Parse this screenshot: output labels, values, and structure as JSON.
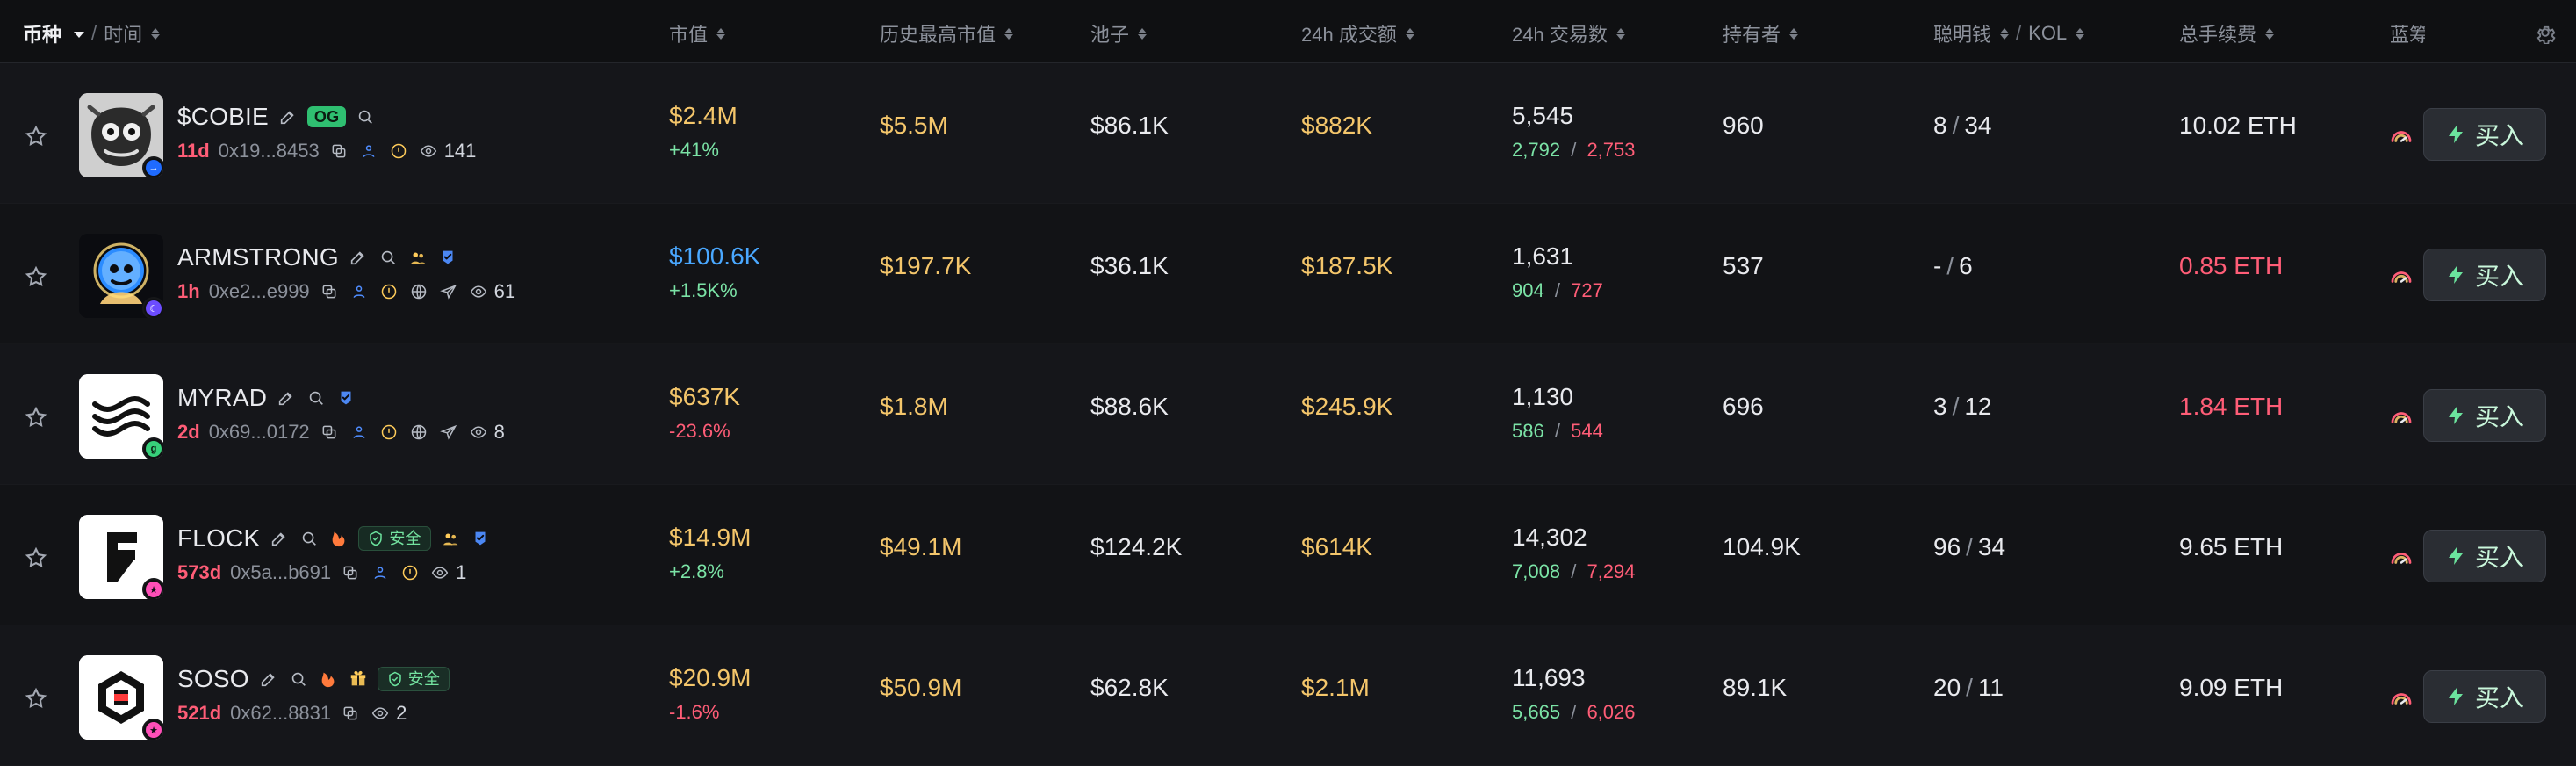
{
  "header": {
    "coin": "币种",
    "time": "时间",
    "slash": "/",
    "mcap": "市值",
    "ath_mcap": "历史最高市值",
    "pool": "池子",
    "vol24h": "24h 成交额",
    "tx24h": "24h 交易数",
    "holders": "持有者",
    "smart": "聪明钱",
    "kol": "KOL",
    "fees": "总手续费",
    "clipped": "蓝筹"
  },
  "colors": {
    "accent_green": "#7be3a6",
    "accent_red": "#ff5d77",
    "accent_gold": "#f4c66b",
    "accent_blue": "#4aa8ff"
  },
  "rows": [
    {
      "symbol": "$COBIE",
      "age": "11d",
      "address": "0x19...8453",
      "views": "141",
      "badges": {
        "og": "OG",
        "safe": ""
      },
      "mcap": "$2.4M",
      "mcap_change": "+41%",
      "mcap_change_dir": "up",
      "ath_mcap": "$5.5M",
      "pool": "$86.1K",
      "vol24h": "$882K",
      "tx24h": "5,545",
      "buys": "2,792",
      "sells": "2,753",
      "holders": "960",
      "smart": "8",
      "kol": "34",
      "fees": "10.02 ETH",
      "fees_color": "normal",
      "buy_label": "买入",
      "avatar_style": "cobie",
      "sticker_icon": "arrow-right-circle-icon",
      "sticker_color": "#1f6bff"
    },
    {
      "symbol": "ARMSTRONG",
      "age": "1h",
      "address": "0xe2...e999",
      "views": "61",
      "badges": {
        "og": "",
        "safe": ""
      },
      "mcap": "$100.6K",
      "mcap_change": "+1.5K%",
      "mcap_change_dir": "up",
      "ath_mcap": "$197.7K",
      "pool": "$36.1K",
      "vol24h": "$187.5K",
      "tx24h": "1,631",
      "buys": "904",
      "sells": "727",
      "holders": "537",
      "smart": "-",
      "kol": "6",
      "fees": "0.85 ETH",
      "fees_color": "red",
      "buy_label": "买入",
      "avatar_style": "armstrong",
      "sticker_icon": "moon-icon",
      "sticker_color": "#6c4cff"
    },
    {
      "symbol": "MYRAD",
      "age": "2d",
      "address": "0x69...0172",
      "views": "8",
      "badges": {
        "og": "",
        "safe": ""
      },
      "mcap": "$637K",
      "mcap_change": "-23.6%",
      "mcap_change_dir": "down",
      "ath_mcap": "$1.8M",
      "pool": "$88.6K",
      "vol24h": "$245.9K",
      "tx24h": "1,130",
      "buys": "586",
      "sells": "544",
      "holders": "696",
      "smart": "3",
      "kol": "12",
      "fees": "1.84 ETH",
      "fees_color": "red",
      "buy_label": "买入",
      "avatar_style": "myrad",
      "sticker_icon": "g-icon",
      "sticker_color": "#37d07a"
    },
    {
      "symbol": "FLOCK",
      "age": "573d",
      "address": "0x5a...b691",
      "views": "1",
      "badges": {
        "og": "",
        "safe": "安全"
      },
      "mcap": "$14.9M",
      "mcap_change": "+2.8%",
      "mcap_change_dir": "up",
      "ath_mcap": "$49.1M",
      "pool": "$124.2K",
      "vol24h": "$614K",
      "tx24h": "14,302",
      "buys": "7,008",
      "sells": "7,294",
      "holders": "104.9K",
      "smart": "96",
      "kol": "34",
      "fees": "9.65 ETH",
      "fees_color": "normal",
      "buy_label": "买入",
      "avatar_style": "flock",
      "sticker_icon": "unicorn-icon",
      "sticker_color": "#ff4fb8"
    },
    {
      "symbol": "SOSO",
      "age": "521d",
      "address": "0x62...8831",
      "views": "2",
      "badges": {
        "og": "",
        "safe": "安全"
      },
      "mcap": "$20.9M",
      "mcap_change": "-1.6%",
      "mcap_change_dir": "down",
      "ath_mcap": "$50.9M",
      "pool": "$62.8K",
      "vol24h": "$2.1M",
      "tx24h": "11,693",
      "buys": "5,665",
      "sells": "6,026",
      "holders": "89.1K",
      "smart": "20",
      "kol": "11",
      "fees": "9.09 ETH",
      "fees_color": "normal",
      "buy_label": "买入",
      "avatar_style": "soso",
      "sticker_icon": "unicorn-icon",
      "sticker_color": "#ff4fb8"
    }
  ]
}
